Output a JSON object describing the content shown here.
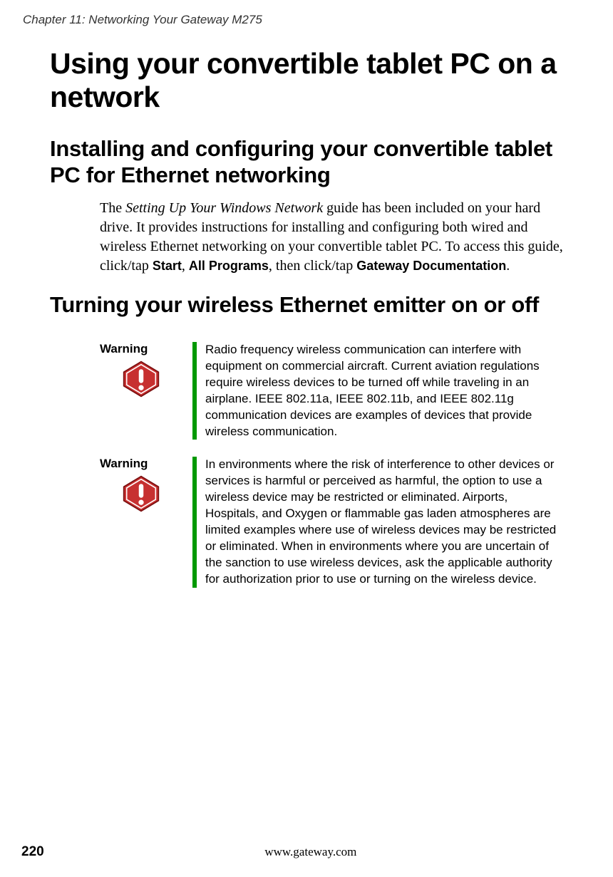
{
  "chapter_header": "Chapter 11: Networking Your Gateway M275",
  "h1": "Using your convertible tablet PC on a network",
  "h2a": "Installing and configuring your convertible tablet PC for Ethernet networking",
  "para1": {
    "lead": "The ",
    "italic": "Setting Up Your Windows Network",
    "mid1": " guide has been included on your hard drive. It provides instructions for installing and configuring both wired and wireless Ethernet networking on your convertible tablet PC. To access this guide, click/tap ",
    "sans1": "Start",
    "comma1": ", ",
    "sans2": "All Programs",
    "mid2": ", then click/tap ",
    "sans3": "Gateway Documentation",
    "end": "."
  },
  "h2b": "Turning your wireless Ethernet emitter on or off",
  "warning_label": "Warning",
  "warning1_text": "Radio frequency wireless communication can interfere with equipment on commercial aircraft. Current aviation regulations require wireless devices to be turned off while traveling in an airplane. IEEE 802.11a, IEEE 802.11b, and IEEE 802.11g communication devices are examples of devices that provide wireless communication.",
  "warning2_text": "In environments where the risk of interference to other devices or services is harmful or perceived as harmful, the option to use a wireless device may be restricted or eliminated. Airports, Hospitals, and Oxygen or flammable gas laden atmospheres are limited examples where use of wireless devices may be restricted or eliminated. When in environments where you are uncertain of the sanction to use wireless devices, ask the applicable authority for authorization prior to use or turning on the wireless device.",
  "footer_page": "220",
  "footer_url": "www.gateway.com"
}
